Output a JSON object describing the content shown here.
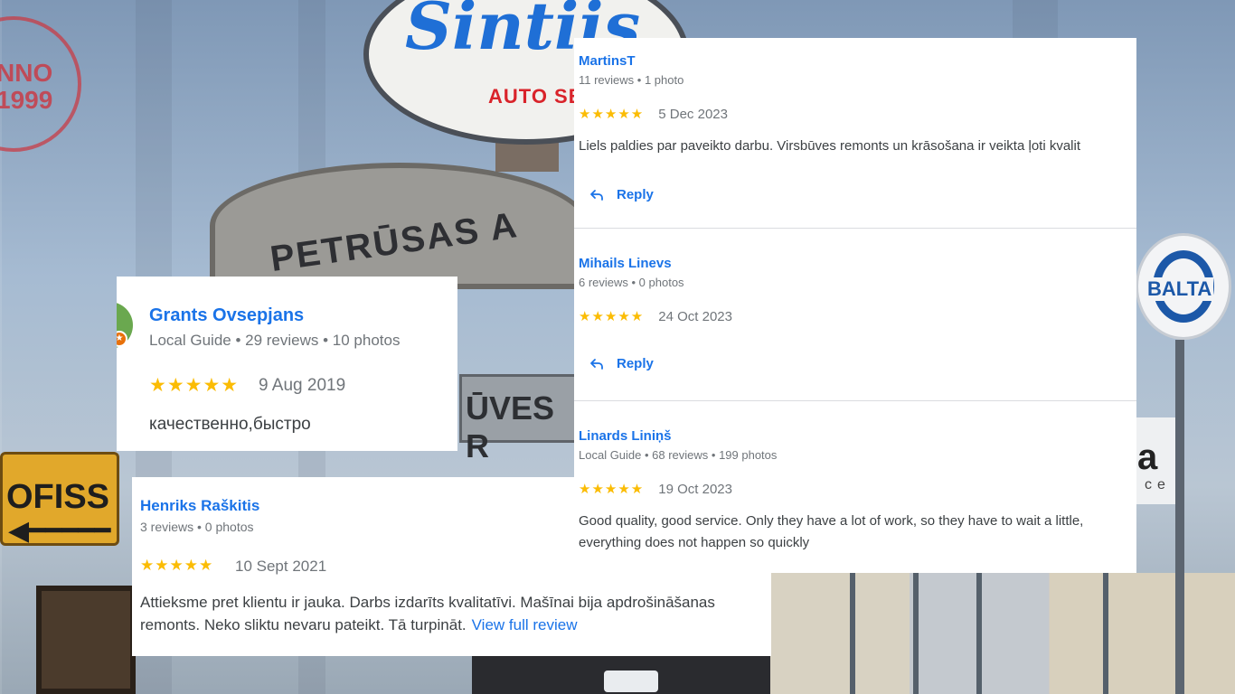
{
  "background": {
    "stamp_text": "NNO 1999",
    "oval_logo": "Sintiis",
    "oval_sub": "AUTO SE",
    "arch_text": "PETRŪSAS A",
    "plate_text": "ŪVES R",
    "ofiss_text": "OFISS",
    "balta_text": "BALTA",
    "right_sign_text": "a",
    "right_sign_sub": "ce"
  },
  "reviews": {
    "grants": {
      "name": "Grants Ovsepjans",
      "meta": "Local Guide • 29 reviews • 10 photos",
      "stars": "★★★★★",
      "date": "9 Aug 2019",
      "text": "качественно,быстро"
    },
    "henriks": {
      "name": "Henriks Raškitis",
      "meta": "3 reviews • 0 photos",
      "stars": "★★★★★",
      "date": "10 Sept 2021",
      "text_line1": "Attieksme pret klientu ir jauka. Darbs izdarīts kvalitatīvi. Mašīnai bija apdrošināšanas",
      "text_line2": "remonts. Neko sliktu nevaru pateikt. Tā turpināt.",
      "more": "View full review"
    },
    "martins": {
      "name": "MartinsT",
      "meta": "11 reviews • 1 photo",
      "stars": "★★★★★",
      "date": "5 Dec 2023",
      "text": "Liels paldies par paveikto darbu. Virsbūves remonts un krāsošana ir veikta ļoti kvalit",
      "reply": "Reply"
    },
    "mihails": {
      "name": "Mihails Linevs",
      "meta": "6 reviews • 0 photos",
      "stars": "★★★★★",
      "date": "24 Oct 2023",
      "reply": "Reply"
    },
    "linards": {
      "name": "Linards Liniņš",
      "meta": "Local Guide • 68 reviews • 199 photos",
      "stars": "★★★★★",
      "date": "19 Oct 2023",
      "text_line1": "Good quality, good service. Only they have a lot of work, so they have to wait a little,",
      "text_line2": "everything does not happen so quickly"
    }
  },
  "colors": {
    "name_link": "#1a73e8",
    "star": "#fbbc04",
    "meta": "#70757a"
  },
  "icons": [
    "reply-arrow-icon",
    "local-guide-badge-icon"
  ]
}
